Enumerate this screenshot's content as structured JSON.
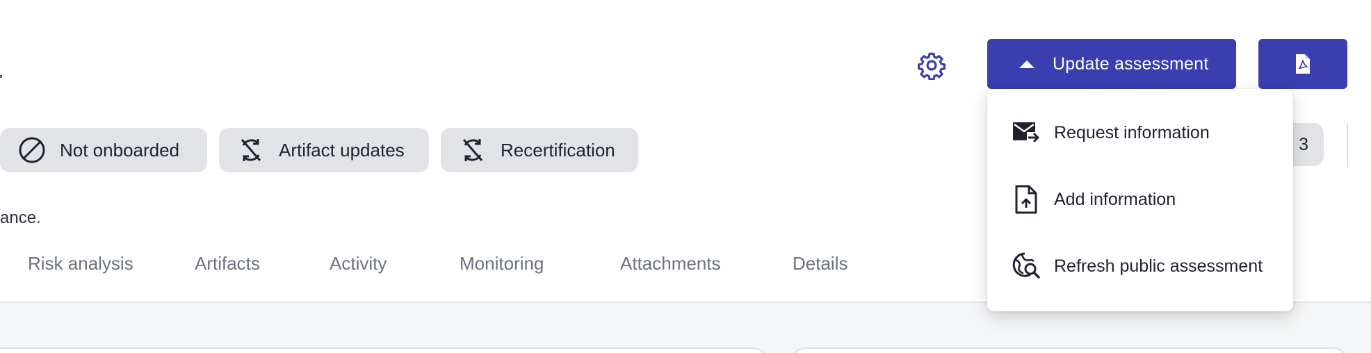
{
  "header": {
    "update_label": "Update assessment",
    "settings_icon": "gear-icon",
    "pdf_icon": "pdf-icon",
    "accent": "#3a3eae"
  },
  "chips": [
    {
      "label": "Not onboarded",
      "icon": "not-allowed-icon"
    },
    {
      "label": "Artifact updates",
      "icon": "sync-disabled-icon"
    },
    {
      "label": "Recertification",
      "icon": "sync-disabled-icon"
    }
  ],
  "right_pill": {
    "text": "3"
  },
  "description": {
    "text": "ance."
  },
  "tabs": [
    {
      "label": "Risk analysis"
    },
    {
      "label": "Artifacts"
    },
    {
      "label": "Activity"
    },
    {
      "label": "Monitoring"
    },
    {
      "label": "Attachments"
    },
    {
      "label": "Details"
    }
  ],
  "menu": {
    "items": [
      {
        "label": "Request information",
        "icon": "mail-send-icon"
      },
      {
        "label": "Add information",
        "icon": "file-upload-icon"
      },
      {
        "label": "Refresh public assessment",
        "icon": "globe-search-icon"
      }
    ]
  }
}
